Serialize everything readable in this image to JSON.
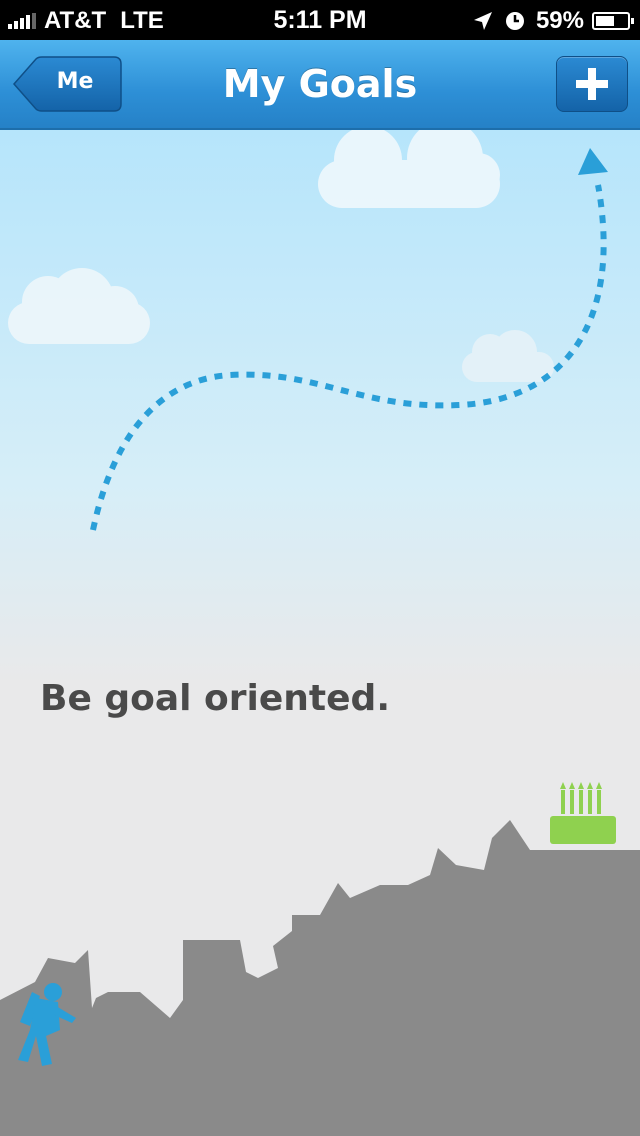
{
  "status_bar": {
    "carrier": "AT&T",
    "network": "LTE",
    "time": "5:11 PM",
    "battery_percent": "59%",
    "battery_level": 0.59
  },
  "nav_bar": {
    "title": "My Goals",
    "back_label": "Me",
    "add_icon": "plus-icon"
  },
  "scene": {
    "tagline": "Be goal oriented.",
    "colors": {
      "path": "#2a9fd8",
      "mountain": "#8a8a8a",
      "climber": "#2a9fd8",
      "cake": "#8fd14f"
    }
  }
}
